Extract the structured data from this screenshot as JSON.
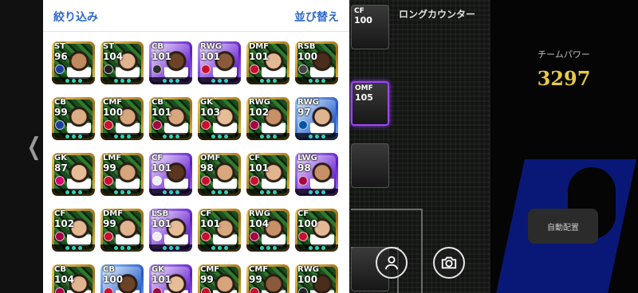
{
  "header": {
    "filter_label": "絞り込み",
    "sort_label": "並び替え"
  },
  "right": {
    "long_counter_label": "ロングカウンター",
    "team_power_label": "チームパワー",
    "team_power_value": "3297",
    "auto_assign_label": "自動配置"
  },
  "pitch_cards": [
    {
      "position": "CF",
      "rating": "100",
      "style": "gold"
    },
    {
      "position": "OMF",
      "rating": "105",
      "style": "purple"
    },
    {
      "position": "",
      "rating": "",
      "style": "gold"
    },
    {
      "position": "",
      "rating": "",
      "style": "gold"
    }
  ],
  "player_rows": [
    [
      {
        "position": "ST",
        "rating": "96",
        "style": "gold",
        "team": "#1d3f9a",
        "skin": "#c08a5c"
      },
      {
        "position": "ST",
        "rating": "104",
        "style": "gold",
        "team": "#222222",
        "skin": "#e0b48e"
      },
      {
        "position": "CB",
        "rating": "101",
        "style": "purple",
        "team": "#2d2d2d",
        "skin": "#6b4327"
      },
      {
        "position": "RWG",
        "rating": "101",
        "style": "purple",
        "team": "#c8102e",
        "skin": "#8a5a3a"
      },
      {
        "position": "DMF",
        "rating": "101",
        "style": "gold",
        "team": "#c8102e",
        "skin": "#e3b995"
      },
      {
        "position": "RSB",
        "rating": "100",
        "style": "gold",
        "team": "#444444",
        "skin": "#4a2d1b"
      }
    ],
    [
      {
        "position": "CB",
        "rating": "99",
        "style": "gold",
        "team": "#1d3f9a",
        "skin": "#dcae86"
      },
      {
        "position": "CMF",
        "rating": "100",
        "style": "gold",
        "team": "#c8102e",
        "skin": "#d9a77d"
      },
      {
        "position": "CB",
        "rating": "101",
        "style": "gold",
        "team": "#a50044",
        "skin": "#d9a77d"
      },
      {
        "position": "GK",
        "rating": "103",
        "style": "gold",
        "team": "#c8102e",
        "skin": "#e7bd98"
      },
      {
        "position": "RWG",
        "rating": "102",
        "style": "gold",
        "team": "#a50044",
        "skin": "#c79066"
      },
      {
        "position": "RWG",
        "rating": "97",
        "style": "blue",
        "team": "#0055a4",
        "skin": "#e0b48e"
      }
    ],
    [
      {
        "position": "GK",
        "rating": "87",
        "style": "gold",
        "team": "#d4006e",
        "skin": "#e7bd98"
      },
      {
        "position": "LMF",
        "rating": "99",
        "style": "gold",
        "team": "#c8102e",
        "skin": "#d6a57c"
      },
      {
        "position": "CF",
        "rating": "101",
        "style": "purple",
        "team": "#eeeeee",
        "skin": "#5a3520"
      },
      {
        "position": "OMF",
        "rating": "98",
        "style": "gold",
        "team": "#c8102e",
        "skin": "#d9a77d"
      },
      {
        "position": "CF",
        "rating": "101",
        "style": "gold",
        "team": "#c8102e",
        "skin": "#e0b48e"
      },
      {
        "position": "LWG",
        "rating": "98",
        "style": "purple",
        "team": "#a50044",
        "skin": "#c79066"
      }
    ],
    [
      {
        "position": "CF",
        "rating": "102",
        "style": "gold",
        "team": "#a50044",
        "skin": "#e3b995"
      },
      {
        "position": "DMF",
        "rating": "99",
        "style": "gold",
        "team": "#c8102e",
        "skin": "#e0b48e"
      },
      {
        "position": "LSB",
        "rating": "101",
        "style": "purple",
        "team": "#eeeeee",
        "skin": "#e7bd98"
      },
      {
        "position": "CF",
        "rating": "101",
        "style": "gold",
        "team": "#c8102e",
        "skin": "#d9a77d"
      },
      {
        "position": "RWG",
        "rating": "104",
        "style": "gold",
        "team": "#a50044",
        "skin": "#c79066"
      },
      {
        "position": "CF",
        "rating": "100",
        "style": "gold",
        "team": "#c8102e",
        "skin": "#e3b995"
      }
    ],
    [
      {
        "position": "CB",
        "rating": "104",
        "style": "gold",
        "team": "#a50044",
        "skin": "#e0b48e"
      },
      {
        "position": "CB",
        "rating": "100",
        "style": "blue",
        "team": "#c8102e",
        "skin": "#6b4327"
      },
      {
        "position": "GK",
        "rating": "101",
        "style": "purple",
        "team": "#a50044",
        "skin": "#e7bd98"
      },
      {
        "position": "CMF",
        "rating": "99",
        "style": "gold",
        "team": "#c8102e",
        "skin": "#d6a57c"
      },
      {
        "position": "CMF",
        "rating": "99",
        "style": "gold",
        "team": "#c8102e",
        "skin": "#8a5a3a"
      },
      {
        "position": "RWG",
        "rating": "100",
        "style": "gold",
        "team": "#222222",
        "skin": "#4a2d1b"
      }
    ]
  ]
}
